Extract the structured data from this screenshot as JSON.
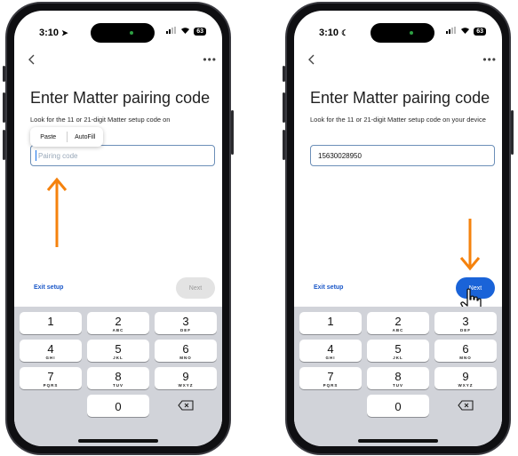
{
  "left_phone": {
    "status": {
      "time": "3:10",
      "battery": "63"
    },
    "title": "Enter Matter pairing code",
    "instruction": "Look for the 11 or 21-digit Matter setup code on",
    "input": {
      "value": "",
      "placeholder": "Pairing code"
    },
    "context_menu": {
      "paste": "Paste",
      "autofill": "AutoFill"
    },
    "exit_label": "Exit setup",
    "next_label": "Next",
    "next_state": "disabled"
  },
  "right_phone": {
    "status": {
      "time": "3:10",
      "battery": "63"
    },
    "title": "Enter Matter pairing code",
    "instruction": "Look for the 11 or 21-digit Matter setup code on your device",
    "input": {
      "value": "15630028950",
      "placeholder": "Pairing code"
    },
    "exit_label": "Exit setup",
    "next_label": "Next",
    "next_state": "enabled"
  },
  "keypad": {
    "keys": [
      {
        "digit": "1",
        "letters": ""
      },
      {
        "digit": "2",
        "letters": "ABC"
      },
      {
        "digit": "3",
        "letters": "DEF"
      },
      {
        "digit": "4",
        "letters": "GHI"
      },
      {
        "digit": "5",
        "letters": "JKL"
      },
      {
        "digit": "6",
        "letters": "MNO"
      },
      {
        "digit": "7",
        "letters": "PQRS"
      },
      {
        "digit": "8",
        "letters": "TUV"
      },
      {
        "digit": "9",
        "letters": "WXYZ"
      },
      {
        "digit": "0",
        "letters": ""
      }
    ]
  },
  "icons": {
    "back": "back-chevron-icon",
    "more": "more-icon",
    "delete": "backspace-icon",
    "annotation": "arrow-icon",
    "pointer": "hand-pointer-icon"
  },
  "colors": {
    "accent": "#1a63d8",
    "annotation_arrow": "#f5820d",
    "input_border": "#6c8fb8"
  }
}
